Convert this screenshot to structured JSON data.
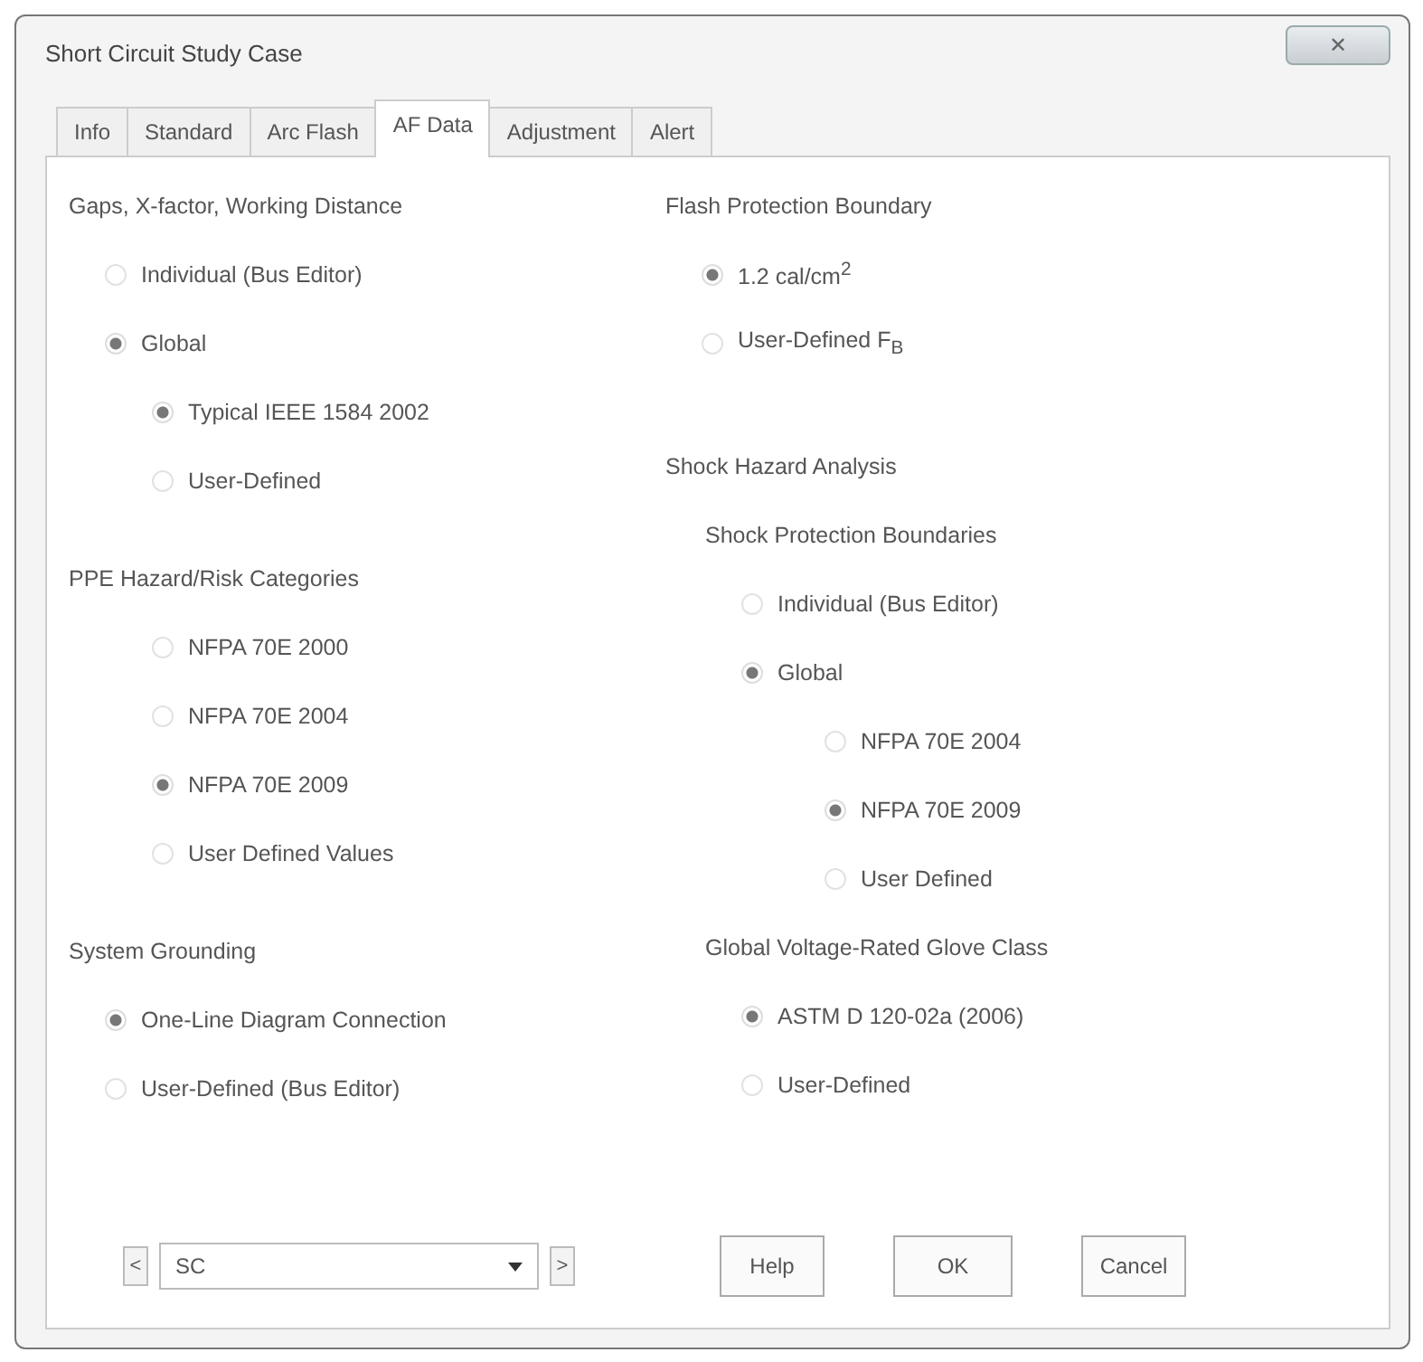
{
  "window": {
    "title": "Short Circuit Study Case",
    "close": "✕"
  },
  "tabs": [
    {
      "label": "Info",
      "selected": false
    },
    {
      "label": "Standard",
      "selected": false
    },
    {
      "label": "Arc Flash",
      "selected": false
    },
    {
      "label": "AF Data",
      "selected": true
    },
    {
      "label": "Adjustment",
      "selected": false
    },
    {
      "label": "Alert",
      "selected": false
    }
  ],
  "columns": [
    [
      {
        "heading": "Gaps, X-factor, Working Distance",
        "options": [
          {
            "label": "Individual (Bus Editor)",
            "selected": false
          },
          {
            "label": "Global",
            "selected": true,
            "children": [
              {
                "label": "Typical IEEE 1584 2002",
                "selected": true
              },
              {
                "label": "User-Defined",
                "selected": false
              }
            ]
          }
        ]
      },
      {
        "heading": "PPE Hazard/Risk Categories",
        "options": [
          {
            "label": "NFPA 70E 2000",
            "selected": false
          },
          {
            "label": "NFPA 70E 2004",
            "selected": false
          },
          {
            "label": "NFPA 70E 2009",
            "selected": true
          },
          {
            "label": "User Defined Values",
            "selected": false
          }
        ]
      },
      {
        "heading": "System Grounding",
        "options": [
          {
            "label": "One-Line Diagram Connection",
            "selected": true
          },
          {
            "label": "User-Defined (Bus Editor)",
            "selected": false
          }
        ]
      }
    ],
    [
      {
        "heading": "Flash Protection Boundary",
        "options": [
          {
            "label": "1.2 cal/cm$^{2}$",
            "selected": true
          },
          {
            "label": "User-Defined F$_{B}$",
            "selected": false
          }
        ]
      },
      {
        "heading": "Shock Hazard Analysis",
        "groups": [
          {
            "heading": "Shock Protection Boundaries",
            "options": [
              {
                "label": "Individual (Bus Editor)",
                "selected": false
              },
              {
                "label": "Global",
                "selected": true,
                "children": [
                  {
                    "label": "NFPA 70E 2004",
                    "selected": false
                  },
                  {
                    "label": "NFPA 70E 2009",
                    "selected": true
                  },
                  {
                    "label": "User Defined",
                    "selected": false
                  }
                ]
              }
            ]
          },
          {
            "heading": "Global Voltage-Rated Glove Class",
            "options": [
              {
                "label": "ASTM D 120-02a (2006)",
                "selected": true
              },
              {
                "label": "User-Defined",
                "selected": false
              }
            ]
          }
        ]
      }
    ]
  ],
  "footer": {
    "prev": "<",
    "combo": "SC",
    "next": ">",
    "buttons": [
      "Help",
      "OK",
      "Cancel"
    ]
  }
}
